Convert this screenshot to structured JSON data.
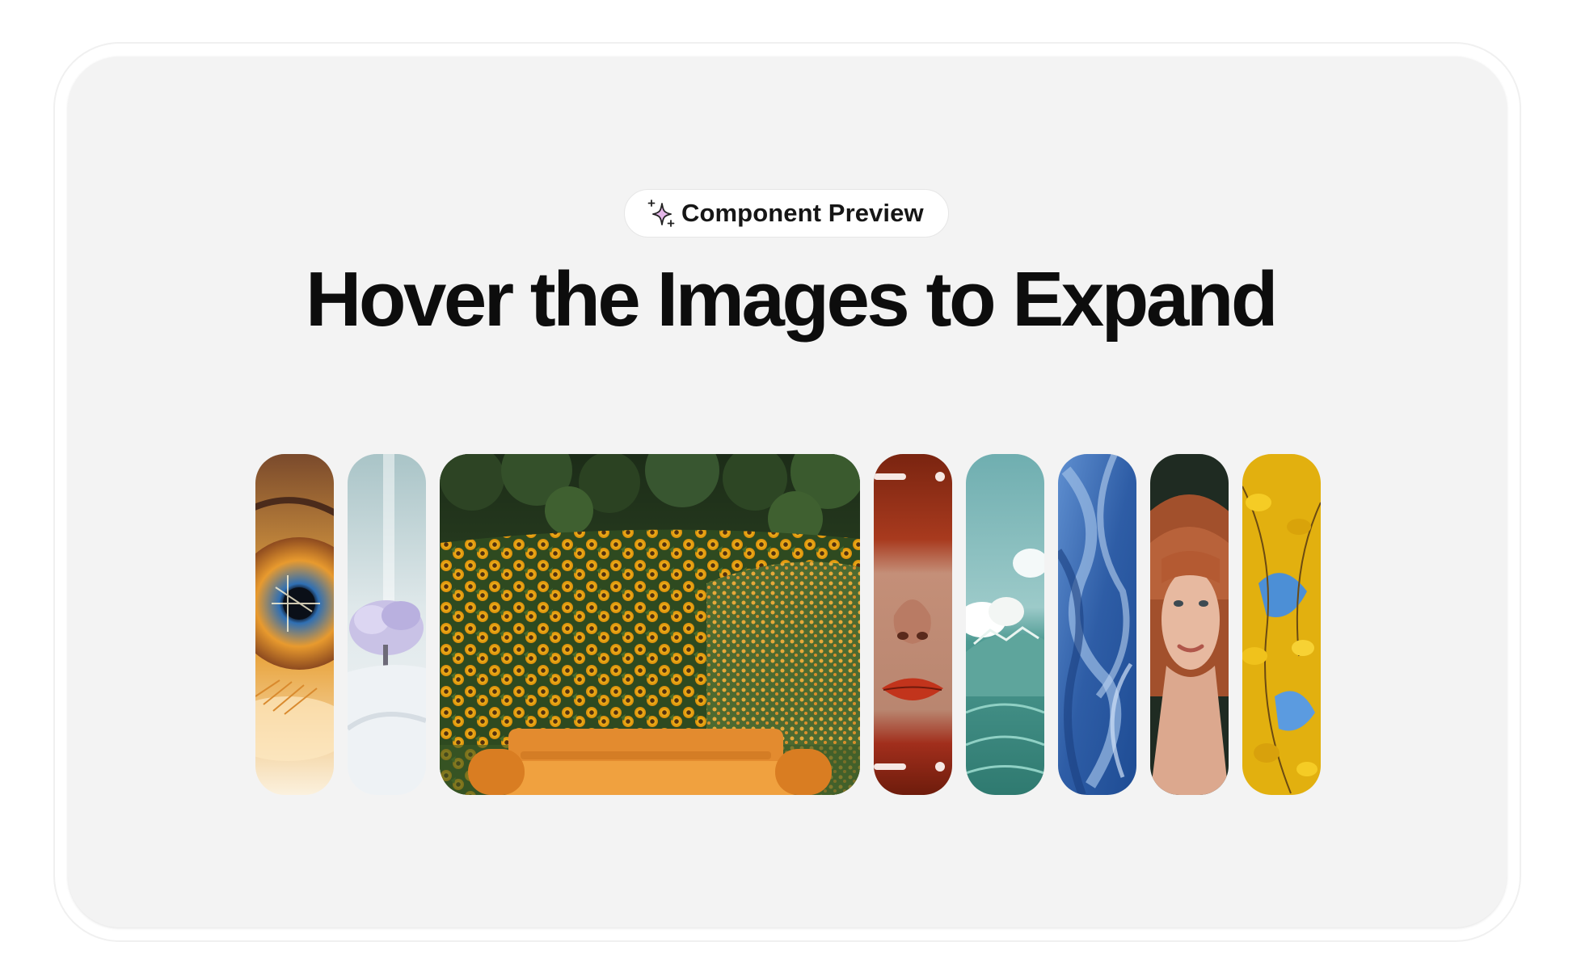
{
  "badge": {
    "label": "Component Preview",
    "icon": "sparkle-icon",
    "icon_color": "#e4b6e8"
  },
  "heading": {
    "title": "Hover the Images to Expand"
  },
  "gallery": {
    "expanded_index": 2,
    "items": [
      {
        "name": "eye",
        "colors": [
          "#c68a3c",
          "#2f6fb3",
          "#f2d8a8"
        ]
      },
      {
        "name": "snowy-tree",
        "colors": [
          "#b9cfd2",
          "#c9c2e6",
          "#eef2f5"
        ]
      },
      {
        "name": "sunflower-sofa",
        "colors": [
          "#2f4a22",
          "#e3a417",
          "#e38b2f"
        ]
      },
      {
        "name": "red-lips",
        "colors": [
          "#7a2410",
          "#c48f78",
          "#a12e1c"
        ]
      },
      {
        "name": "ocean-wave",
        "colors": [
          "#7fb7b8",
          "#ffffff",
          "#3f8e86"
        ]
      },
      {
        "name": "blue-smoke",
        "colors": [
          "#1e4c94",
          "#7fa6d6",
          "#5a86c6"
        ]
      },
      {
        "name": "red-haired-woman",
        "colors": [
          "#1f2b22",
          "#b8623a",
          "#e7b9a0"
        ]
      },
      {
        "name": "yellow-leaves",
        "colors": [
          "#e8b90f",
          "#4c8fd6",
          "#6b4a12"
        ]
      }
    ]
  }
}
